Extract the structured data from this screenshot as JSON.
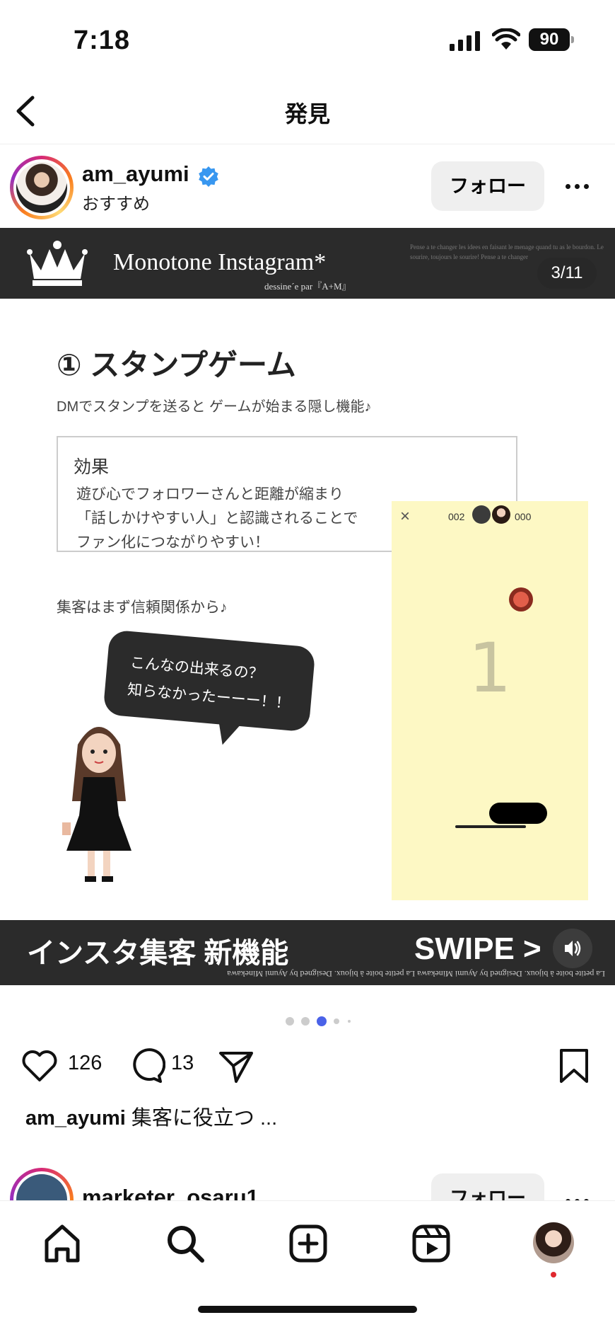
{
  "status_bar": {
    "time": "7:18",
    "battery": "90"
  },
  "header": {
    "title": "発見"
  },
  "post": {
    "username": "am_ayumi",
    "subtitle": "おすすめ",
    "follow_label": "フォロー",
    "image_counter": "3/11",
    "slide": {
      "banner_title": "Monotone Instagram*",
      "banner_sub": "dessine´e par『A+M』",
      "banner_deco": "Pense a te changer les idees en faisant le menage quand tu as le bourdon. Le sourire, toujours le sourire! Pense a te changer",
      "title": "① スタンプゲーム",
      "desc": "DMでスタンプを送ると ゲームが始まる隠し機能♪",
      "effect_title": "効果",
      "effect_lines": [
        "遊び心でフォロワーさんと距離が縮まり",
        "「話しかけやすい人」と認識されることで",
        "ファン化につながりやすい！"
      ],
      "note": "集客はまず信頼関係から♪",
      "bubble_lines": [
        "こんなの出来るの？",
        "知らなかったーーー！！"
      ],
      "game": {
        "close": "×",
        "score_left": "002",
        "score_right": "000",
        "count": "1"
      },
      "bottom_left": "インスタ集客 新機能",
      "bottom_right": "SWIPE >",
      "bottom_deco": "La petite boite à bijoux.   Designed by   Ayumi Minekawa   La petite boite à bijoux.   Designed by   Ayumi Minekawa"
    },
    "carousel_dots": {
      "count": 5,
      "active": 2
    },
    "likes": "126",
    "comments": "13",
    "caption_user": "am_ayumi",
    "caption_text": "集客に役立つ ..."
  },
  "next_post": {
    "username": "marketer_osaru1",
    "follow_label": "フォロー"
  },
  "tabbar": {
    "icons": [
      "home-icon",
      "search-icon",
      "create-icon",
      "reels-icon",
      "profile-avatar"
    ]
  },
  "colors": {
    "verified": "#3897f0",
    "notification": "#e0282e",
    "dot_active": "#4a62e8"
  }
}
